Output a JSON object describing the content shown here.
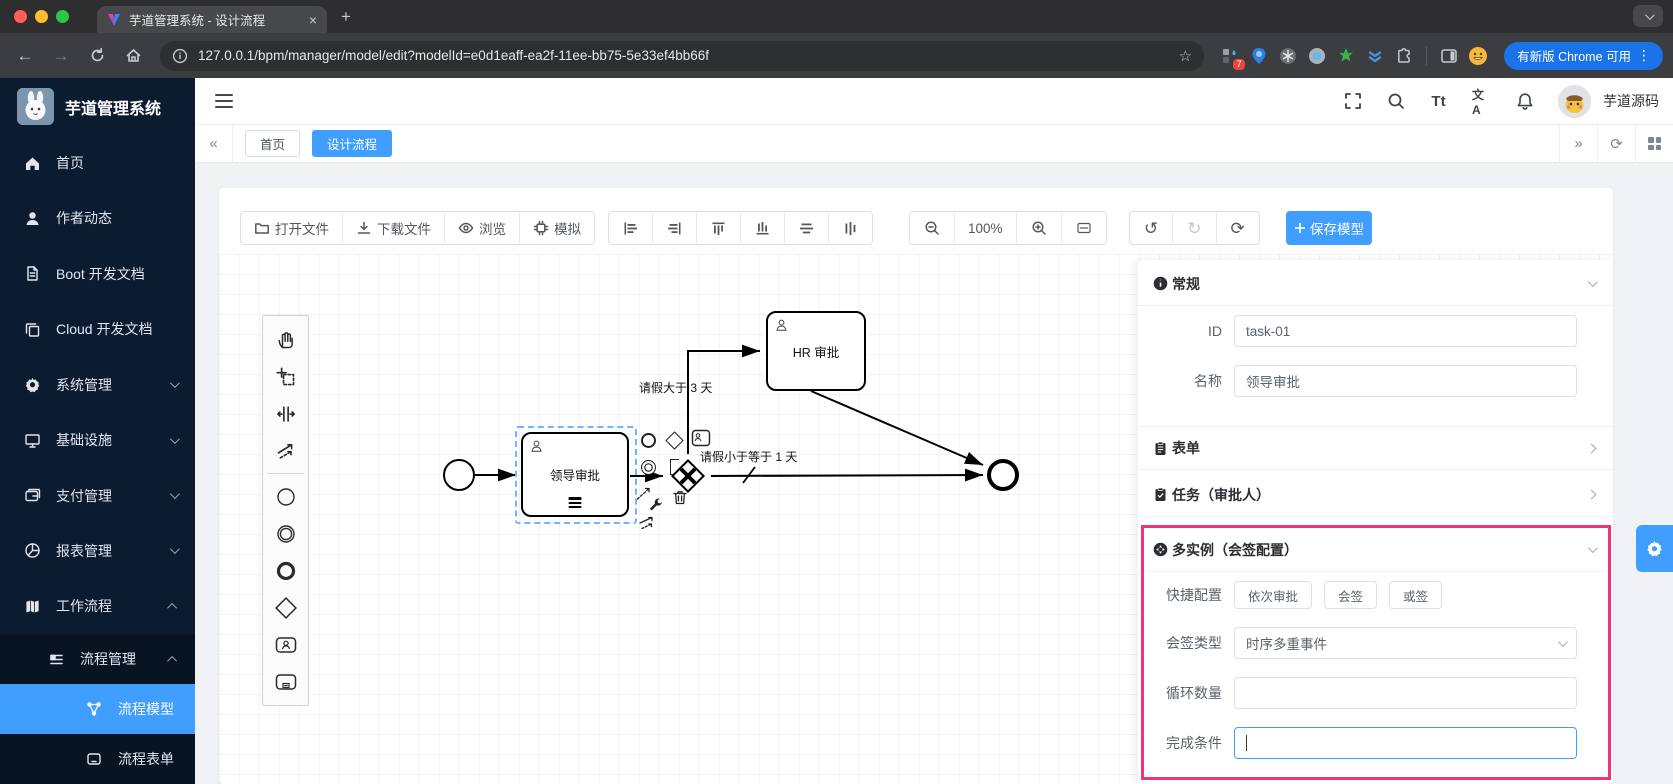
{
  "browser": {
    "tab_title": "芋道管理系统 - 设计流程",
    "url": "127.0.0.1/bpm/manager/model/edit?modelId=e0d1eaff-ea2f-11ee-bb75-5e33ef4bb66f",
    "extension_badge": "7",
    "update_button": "有新版 Chrome 可用"
  },
  "glyphs": {
    "back": "←",
    "forward": "→",
    "star": "☆",
    "kebab": "⋮",
    "collapse_left": "«",
    "expand_right": "»",
    "undo": "↺",
    "redo": "↻",
    "refresh": "⟳",
    "close_tab": "×",
    "new_tab": "+",
    "font_size": "Tt",
    "translate": "文A",
    "plus": "+"
  },
  "sidebar": {
    "title": "芋道管理系统",
    "items": [
      {
        "label": "首页"
      },
      {
        "label": "作者动态"
      },
      {
        "label": "Boot 开发文档"
      },
      {
        "label": "Cloud 开发文档"
      },
      {
        "label": "系统管理"
      },
      {
        "label": "基础设施"
      },
      {
        "label": "支付管理"
      },
      {
        "label": "报表管理"
      },
      {
        "label": "工作流程"
      }
    ],
    "submenu_label": "流程管理",
    "subitems": [
      {
        "label": "流程模型"
      },
      {
        "label": "流程表单"
      }
    ]
  },
  "header": {
    "username": "芋道源码"
  },
  "tags": {
    "items": [
      {
        "label": "首页"
      },
      {
        "label": "设计流程"
      }
    ]
  },
  "toolbar": {
    "open": "打开文件",
    "download": "下载文件",
    "preview": "浏览",
    "simulate": "模拟",
    "zoom_level": "100%",
    "save": "保存模型"
  },
  "canvas": {
    "task_leader": "领导审批",
    "task_hr": "HR 审批",
    "label_gt3": "请假大于 3 天",
    "label_lte1": "请假小于等于 1 天"
  },
  "panel": {
    "general": {
      "title": "常规",
      "id_label": "ID",
      "id_value": "task-01",
      "name_label": "名称",
      "name_value": "领导审批"
    },
    "form_title": "表单",
    "task_title": "任务（审批人）",
    "multi": {
      "title": "多实例（会签配置）",
      "quick_label": "快捷配置",
      "quick_options": [
        {
          "label": "依次审批"
        },
        {
          "label": "会签"
        },
        {
          "label": "或签"
        }
      ],
      "type_label": "会签类型",
      "type_value": "时序多重事件",
      "loop_label": "循环数量",
      "cond_label": "完成条件",
      "cond_value": ""
    }
  },
  "colors": {
    "primary": "#409eff",
    "highlight": "#f0347c"
  }
}
